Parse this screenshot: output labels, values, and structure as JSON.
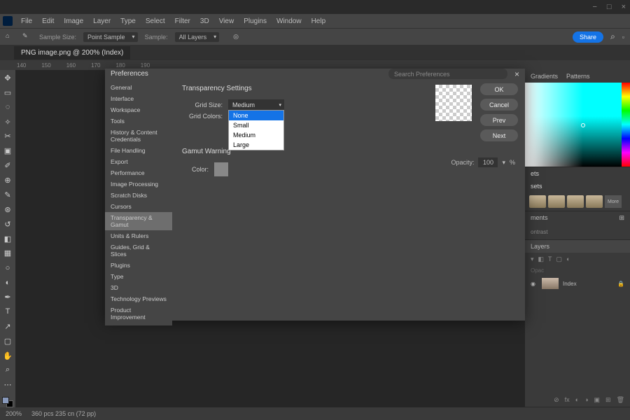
{
  "titlebar": {
    "min": "−",
    "max": "□",
    "close": "×"
  },
  "menu": [
    "File",
    "Edit",
    "Image",
    "Layer",
    "Type",
    "Select",
    "Filter",
    "3D",
    "View",
    "Plugins",
    "Window",
    "Help"
  ],
  "options": {
    "sample_size_label": "Sample Size:",
    "sample_size_value": "Point Sample",
    "sample_label": "Sample:",
    "sample_value": "All Layers",
    "share": "Share"
  },
  "tab": "PNG image.png @ 200% (Index)",
  "ruler": [
    "140",
    "150",
    "160",
    "170",
    "180",
    "190"
  ],
  "status": {
    "zoom": "200%",
    "info": "360 pcs 235 cn (72 pp)"
  },
  "right": {
    "color_tabs": [
      "Gradients",
      "Patterns"
    ],
    "lib_headers": [
      "ets",
      "sets"
    ],
    "more": "More",
    "adjustments": "ments",
    "contrast": "ontrast",
    "layers": "Layers",
    "opacity_label": "Opac",
    "layer_name": "Index"
  },
  "prefs": {
    "title": "Preferences",
    "search_placeholder": "Search Preferences",
    "categories": [
      "General",
      "Interface",
      "Workspace",
      "Tools",
      "History & Content Credentials",
      "File Handling",
      "Export",
      "Performance",
      "Image Processing",
      "Scratch Disks",
      "Cursors",
      "Transparency & Gamut",
      "Units & Rulers",
      "Guides, Grid & Slices",
      "Plugins",
      "Type",
      "3D",
      "Technology Previews",
      "Product Improvement"
    ],
    "selected_category_index": 11,
    "transparency_section": "Transparency Settings",
    "grid_size_label": "Grid Size:",
    "grid_size_value": "Medium",
    "grid_size_options": [
      "None",
      "Small",
      "Medium",
      "Large"
    ],
    "grid_size_highlight_index": 0,
    "grid_colors_label": "Grid Colors:",
    "gamut_section": "Gamut Warning",
    "color_label": "Color:",
    "opacity_label": "Opacity:",
    "opacity_value": "100",
    "opacity_suffix": "%",
    "buttons": {
      "ok": "OK",
      "cancel": "Cancel",
      "prev": "Prev",
      "next": "Next"
    }
  }
}
